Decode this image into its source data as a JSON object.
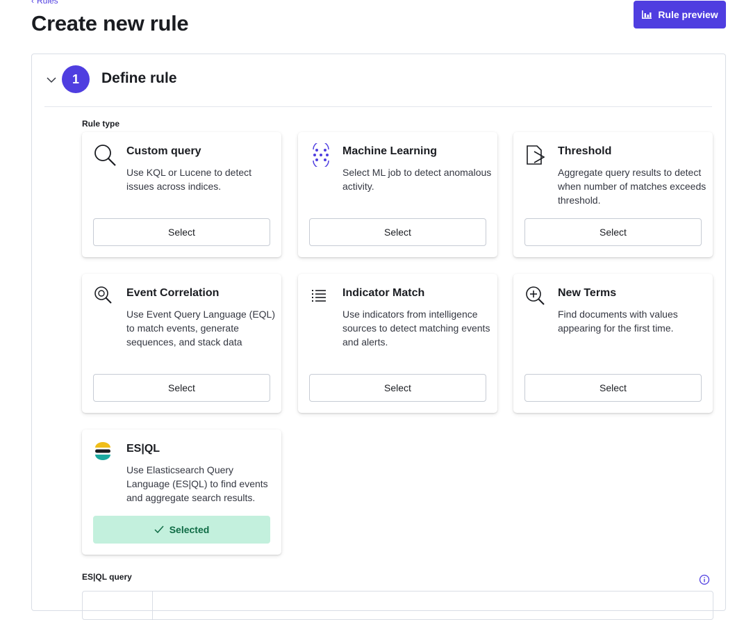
{
  "breadcrumb": {
    "back_label": "Rules"
  },
  "page": {
    "title": "Create new rule"
  },
  "toolbar": {
    "preview_label": "Rule preview"
  },
  "step": {
    "number": "1",
    "title": "Define rule"
  },
  "rule_type": {
    "label": "Rule type",
    "cards": [
      {
        "title": "Custom query",
        "description": "Use KQL or Lucene to detect issues across indices.",
        "button": "Select",
        "icon": "magnifier-icon"
      },
      {
        "title": "Machine Learning",
        "description": "Select ML job to detect anomalous activity.",
        "button": "Select",
        "icon": "ml-icon"
      },
      {
        "title": "Threshold",
        "description": "Aggregate query results to detect when number of matches exceeds threshold.",
        "button": "Select",
        "icon": "threshold-icon"
      },
      {
        "title": "Event Correlation",
        "description": "Use Event Query Language (EQL) to match events, generate sequences, and stack data",
        "button": "Select",
        "icon": "correlation-icon"
      },
      {
        "title": "Indicator Match",
        "description": "Use indicators from intelligence sources to detect matching events and alerts.",
        "button": "Select",
        "icon": "list-icon"
      },
      {
        "title": "New Terms",
        "description": "Find documents with values appearing for the first time.",
        "button": "Select",
        "icon": "zoom-plus-icon"
      },
      {
        "title": "ES|QL",
        "description": "Use Elasticsearch Query Language (ES|QL) to find events and aggregate search results.",
        "button": "Selected",
        "icon": "elastic-logo-icon"
      }
    ]
  },
  "esql_query": {
    "label": "ES|QL query"
  },
  "colors": {
    "accent": "#4f3ee0",
    "selected_bg": "#c3f0dd",
    "selected_text": "#0f6b45"
  }
}
